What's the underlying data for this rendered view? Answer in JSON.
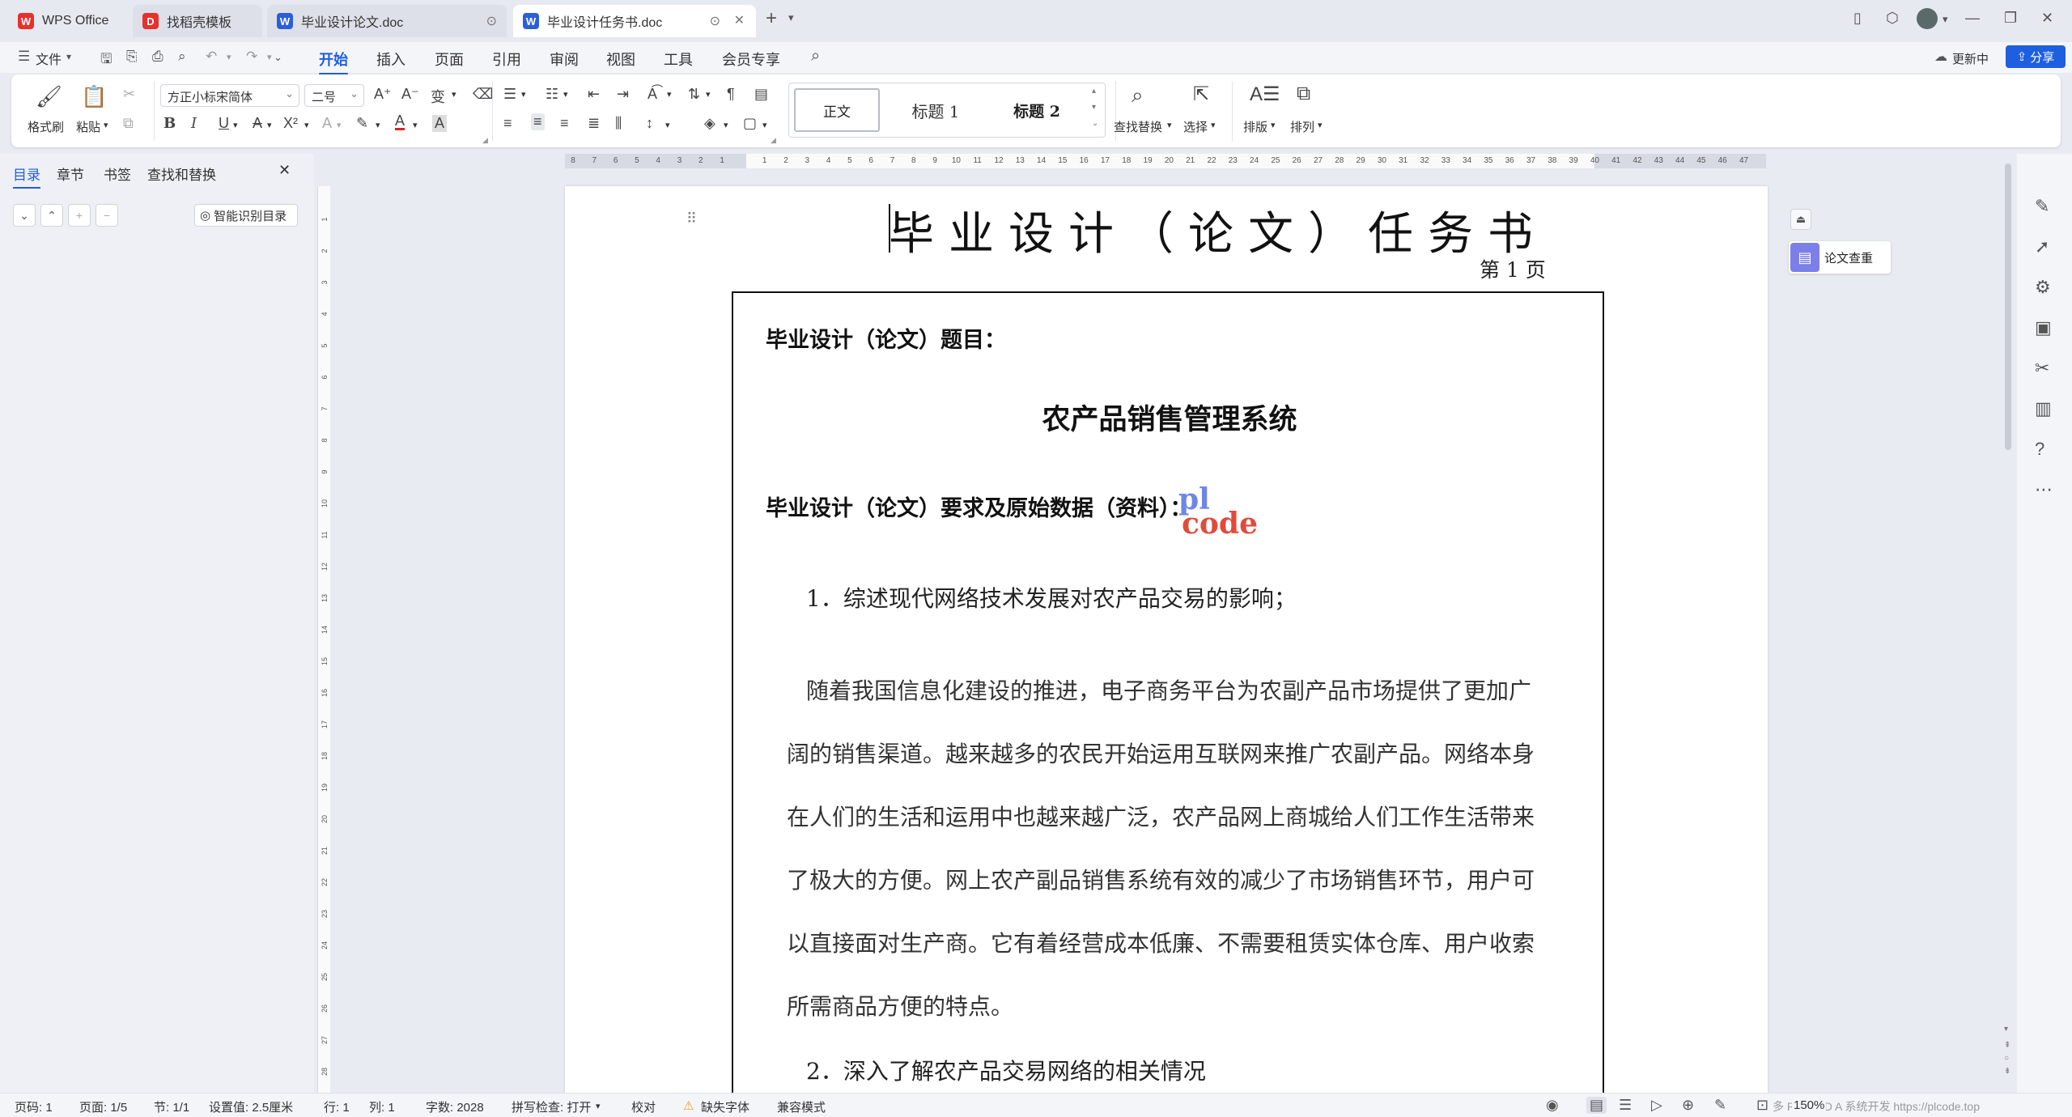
{
  "tabs": [
    {
      "label": "WPS Office",
      "icon": "wps-logo-icon"
    },
    {
      "label": "找稻壳模板",
      "icon": "docer-icon"
    },
    {
      "label": "毕业设计论文.doc",
      "icon": "word-doc-icon"
    },
    {
      "label": "毕业设计任务书.doc",
      "icon": "word-doc-icon"
    }
  ],
  "menu": {
    "file": "文件",
    "items": [
      "开始",
      "插入",
      "页面",
      "引用",
      "审阅",
      "视图",
      "工具",
      "会员专享"
    ],
    "active": "开始",
    "update": "更新中",
    "share": "分享"
  },
  "ribbon": {
    "format_painter": "格式刷",
    "paste": "粘贴",
    "font_name": "方正小标宋简体",
    "font_size": "二号",
    "styles": [
      "正文",
      "标题 1",
      "标题 2"
    ],
    "find_replace": "查找替换",
    "select": "选择",
    "layout": "排版",
    "arrange": "排列"
  },
  "nav": {
    "tabs": [
      "目录",
      "章节",
      "书签",
      "查找和替换"
    ],
    "smart_toc": "智能识别目录"
  },
  "ruler_h": [
    "8",
    "7",
    "6",
    "5",
    "4",
    "3",
    "2",
    "1",
    "",
    "1",
    "2",
    "3",
    "4",
    "5",
    "6",
    "7",
    "8",
    "9",
    "10",
    "11",
    "12",
    "13",
    "14",
    "15",
    "16",
    "17",
    "18",
    "19",
    "20",
    "21",
    "22",
    "23",
    "24",
    "25",
    "26",
    "27",
    "28",
    "29",
    "30",
    "31",
    "32",
    "33",
    "34",
    "35",
    "36",
    "37",
    "38",
    "39",
    "40",
    "41",
    "42",
    "43",
    "44",
    "45",
    "46",
    "47"
  ],
  "ruler_v": [
    "1",
    "2",
    "3",
    "4",
    "5",
    "6",
    "7",
    "8",
    "9",
    "10",
    "11",
    "12",
    "13",
    "14",
    "15",
    "16",
    "17",
    "18",
    "19",
    "20",
    "21",
    "22",
    "23",
    "24",
    "25",
    "26",
    "27",
    "28"
  ],
  "document": {
    "title": "毕业设计（论文）任务书",
    "page_label": "第 1 页",
    "subject_label": "毕业设计（论文）题目：",
    "subject": "农产品销售管理系统",
    "requirements_label": "毕业设计（论文）要求及原始数据（资料）：",
    "item1": "1．综述现代网络技术发展对农产品交易的影响；",
    "paragraph_lines": [
      "随着我国信息化建设的推进，电子商务平台为农副产品市场提供了更加广",
      "阔的销售渠道。越来越多的农民开始运用互联网来推广农副产品。网络本身",
      "在人们的生活和运用中也越来越广泛，农产品网上商城给人们工作生活带来",
      "了极大的方便。网上农产副品销售系统有效的减少了市场销售环节，用户可",
      "以直接面对生产商。它有着经营成本低廉、不需要租赁实体仓库、用户收索",
      "所需商品方便的特点。"
    ],
    "item2": "2．深入了解农产品交易网络的相关情况",
    "watermark_top": "pl",
    "watermark_bottom": "code"
  },
  "right_panel": {
    "check": "论文查重"
  },
  "status": {
    "page": "页码: 1",
    "pages": "页面: 1/5",
    "section": "节: 1/1",
    "setting": "设置值: 2.5厘米",
    "row": "行: 1",
    "col": "列: 1",
    "words": "字数: 2028",
    "spell": "拼写检查: 打开",
    "proof": "校对",
    "missing_font": "缺失字体",
    "compat": "兼容模式",
    "zoom": "150%",
    "overlay": "多 R 3 - 3 D A 系统开发 https://plcode.top"
  },
  "colors": {
    "accent": "#1e5fe0",
    "wps_red": "#e8302c",
    "word_blue": "#2b5fd9",
    "check_purple": "#7d7fe8"
  }
}
